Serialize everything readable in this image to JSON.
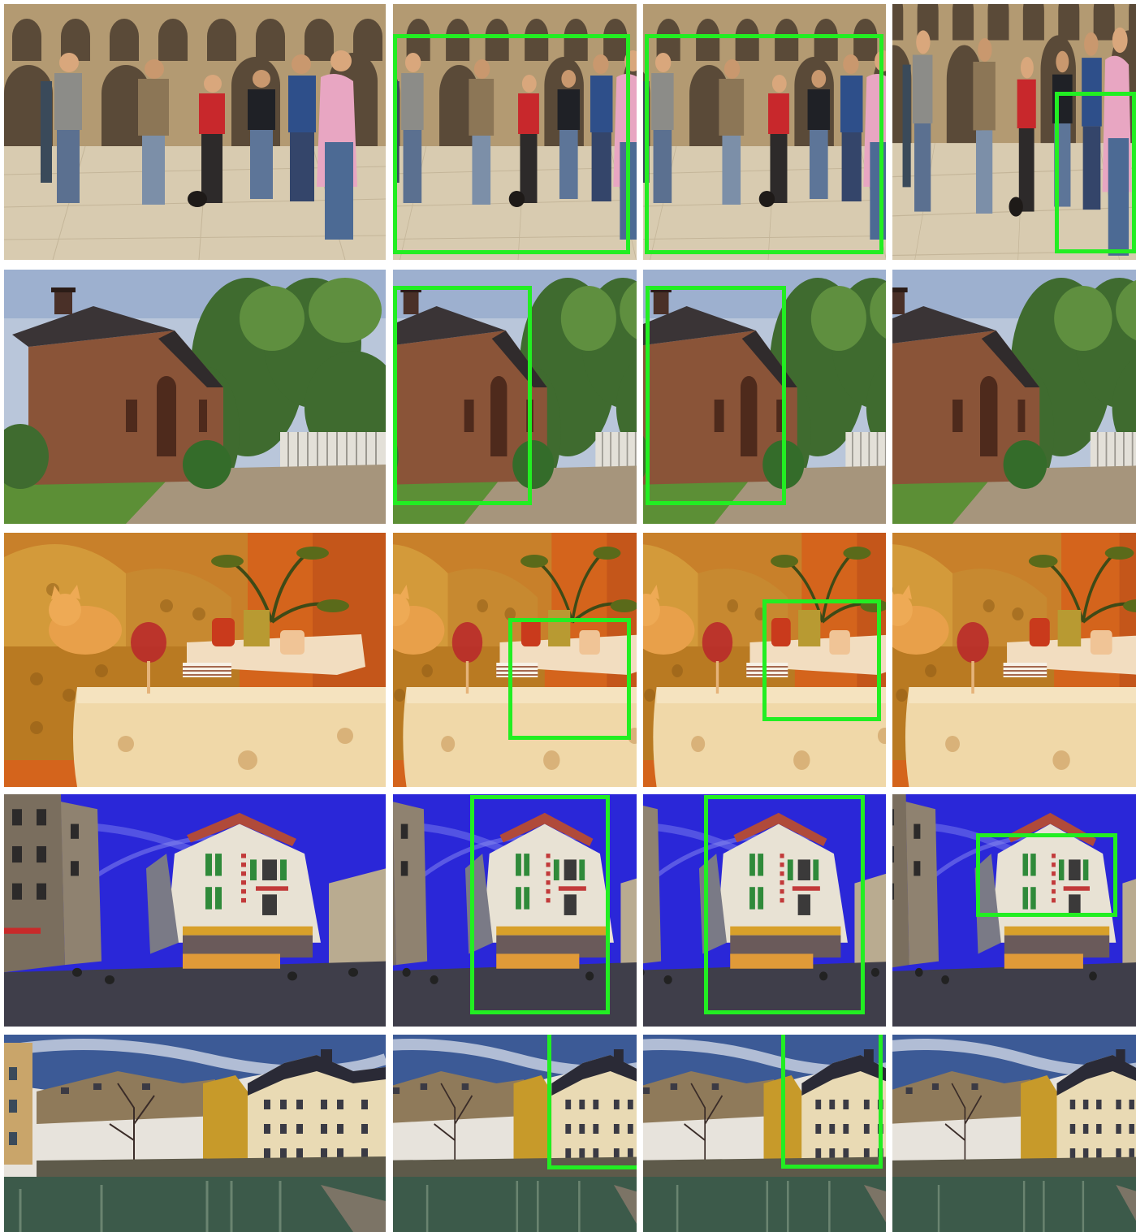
{
  "grid": {
    "rows": 5,
    "columns": 4
  },
  "box_color": "#22ee22",
  "rows": [
    {
      "scene": "courtyard-group",
      "cells": [
        {
          "column": "original",
          "has_box": false
        },
        {
          "column": "crop-a",
          "has_box": true
        },
        {
          "column": "crop-b",
          "has_box": true
        },
        {
          "column": "crop-c",
          "has_box": true
        }
      ]
    },
    {
      "scene": "brick-hut",
      "cells": [
        {
          "column": "original",
          "has_box": false
        },
        {
          "column": "crop-a",
          "has_box": true
        },
        {
          "column": "crop-b",
          "has_box": true
        },
        {
          "column": "crop-c",
          "has_box": false
        }
      ]
    },
    {
      "scene": "cat-candles",
      "cells": [
        {
          "column": "original",
          "has_box": false
        },
        {
          "column": "crop-a",
          "has_box": true
        },
        {
          "column": "crop-b",
          "has_box": true
        },
        {
          "column": "crop-c",
          "has_box": false
        }
      ]
    },
    {
      "scene": "brasserie-street",
      "cells": [
        {
          "column": "original",
          "has_box": false
        },
        {
          "column": "crop-a",
          "has_box": true
        },
        {
          "column": "crop-b",
          "has_box": true
        },
        {
          "column": "crop-c",
          "has_box": true
        }
      ]
    },
    {
      "scene": "canal-town",
      "cells": [
        {
          "column": "original",
          "has_box": false
        },
        {
          "column": "crop-a",
          "has_box": true
        },
        {
          "column": "crop-b",
          "has_box": true
        },
        {
          "column": "crop-c",
          "has_box": false
        }
      ]
    }
  ]
}
